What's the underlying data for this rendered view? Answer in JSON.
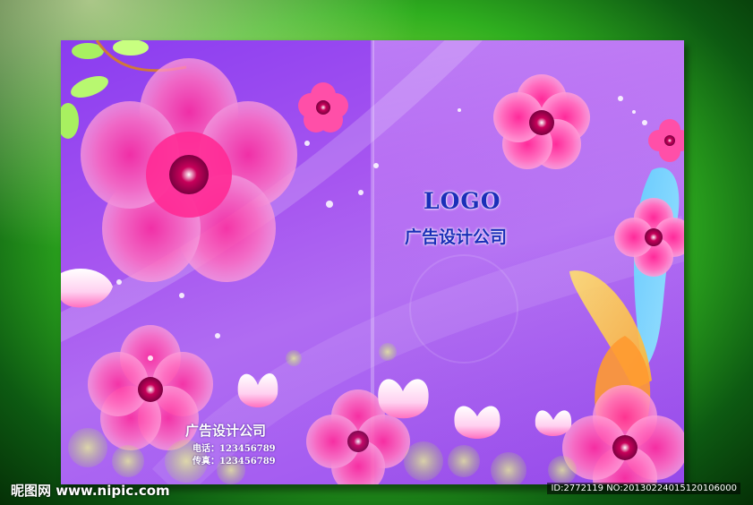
{
  "cover": {
    "logo": "LOGO",
    "company_title": "广告设计公司",
    "back_company_title": "广告设计公司",
    "phone": "电话：123456789",
    "fax": "传真：123456789"
  },
  "watermark": {
    "site": "昵图网 www.nipic.com",
    "id_line": "ID:2772119 NO:20130224015120106000"
  },
  "colors": {
    "background_green": "#2fae1f",
    "cover_purple": "#a655f0",
    "flower_pink": "#ff3fa8",
    "logo_blue": "#1a2fb8"
  }
}
